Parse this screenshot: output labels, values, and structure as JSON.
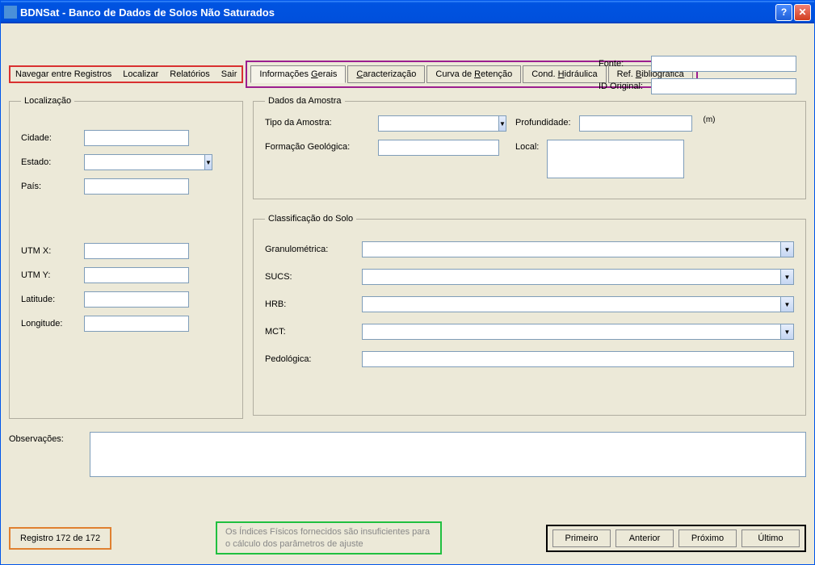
{
  "title": "BDNSat - Banco de Dados de Solos Não Saturados",
  "menubar": {
    "navegar": "Navegar entre Registros",
    "localizar": "Localizar",
    "relatorios": "Relatórios",
    "sair": "Sair"
  },
  "top": {
    "fonte_label": "Fonte:",
    "fonte": "",
    "id_label": "ID Original:",
    "id": ""
  },
  "tabs": {
    "gerais": "Informações ",
    "gerais_u": "G",
    "gerais2": "erais",
    "caract": "Caracterização",
    "caract_u": "C",
    "curva": "Curva de ",
    "curva_u": "R",
    "curva2": "etenção",
    "cond": "Cond. ",
    "cond_u": "H",
    "cond2": "idráulica",
    "ref": "Ref. ",
    "ref_u": "B",
    "ref2": "ibliográfica"
  },
  "loc": {
    "legend": "Localização",
    "cidade_l": "Cidade:",
    "cidade": "",
    "estado_l": "Estado:",
    "estado": "",
    "pais_l": "País:",
    "pais": "",
    "utmx_l": "UTM X:",
    "utmx": "",
    "utmy_l": "UTM Y:",
    "utmy": "",
    "lat_l": "Latitude:",
    "lat": "",
    "lon_l": "Longitude:",
    "lon": ""
  },
  "amostra": {
    "legend": "Dados da Amostra",
    "tipo_l": "Tipo da Amostra:",
    "tipo": "",
    "prof_l": "Profundidade:",
    "prof": "",
    "prof_unit": "(m)",
    "form_l": "Formação Geológica:",
    "form": "",
    "local_l": "Local:",
    "local": ""
  },
  "classif": {
    "legend": "Classificação do Solo",
    "gran_l": "Granulométrica:",
    "gran": "",
    "sucs_l": "SUCS:",
    "sucs": "",
    "hrb_l": "HRB:",
    "hrb": "",
    "mct_l": "MCT:",
    "mct": "",
    "ped_l": "Pedológica:",
    "ped": ""
  },
  "obs": {
    "label": "Observações:",
    "text": ""
  },
  "footer": {
    "registro": "Registro 172 de 172",
    "warn": "Os Índices Físicos fornecidos são insuficientes para o cálculo dos parâmetros de ajuste",
    "primeiro": "Primeiro",
    "anterior": "Anterior",
    "proximo": "Próximo",
    "ultimo": "Último"
  }
}
